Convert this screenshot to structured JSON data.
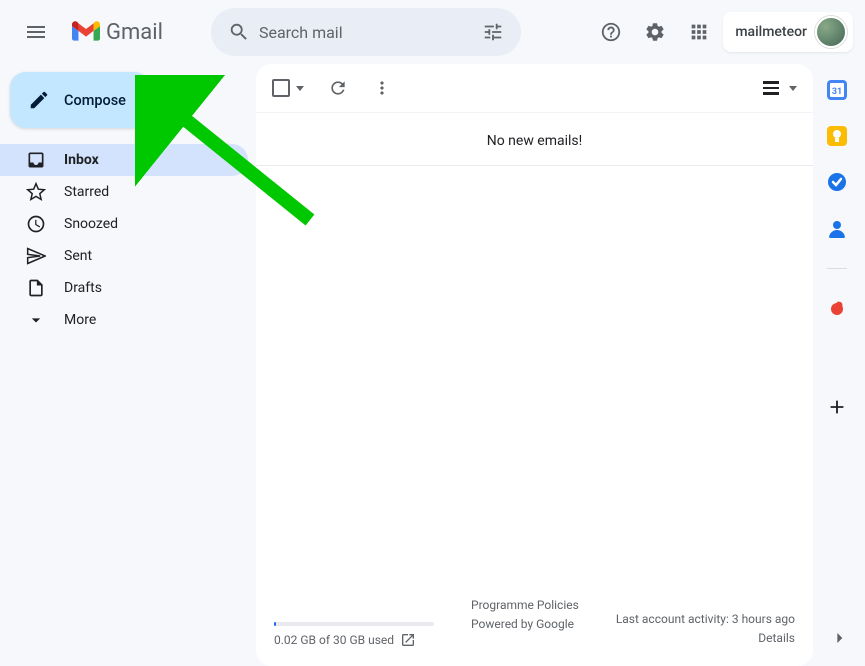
{
  "header": {
    "product_name": "Gmail",
    "search_placeholder": "Search mail",
    "account_label": "mailmeteor"
  },
  "compose_label": "Compose",
  "sidebar": {
    "items": [
      {
        "label": "Inbox"
      },
      {
        "label": "Starred"
      },
      {
        "label": "Snoozed"
      },
      {
        "label": "Sent"
      },
      {
        "label": "Drafts"
      },
      {
        "label": "More"
      }
    ]
  },
  "main": {
    "empty_message": "No new emails!"
  },
  "footer": {
    "storage_text": "0.02 GB of 30 GB used",
    "policies": "Programme Policies",
    "powered": "Powered by Google",
    "activity": "Last account activity: 3 hours ago",
    "details": "Details"
  },
  "annotation": {
    "arrow_target": "compose-button"
  }
}
